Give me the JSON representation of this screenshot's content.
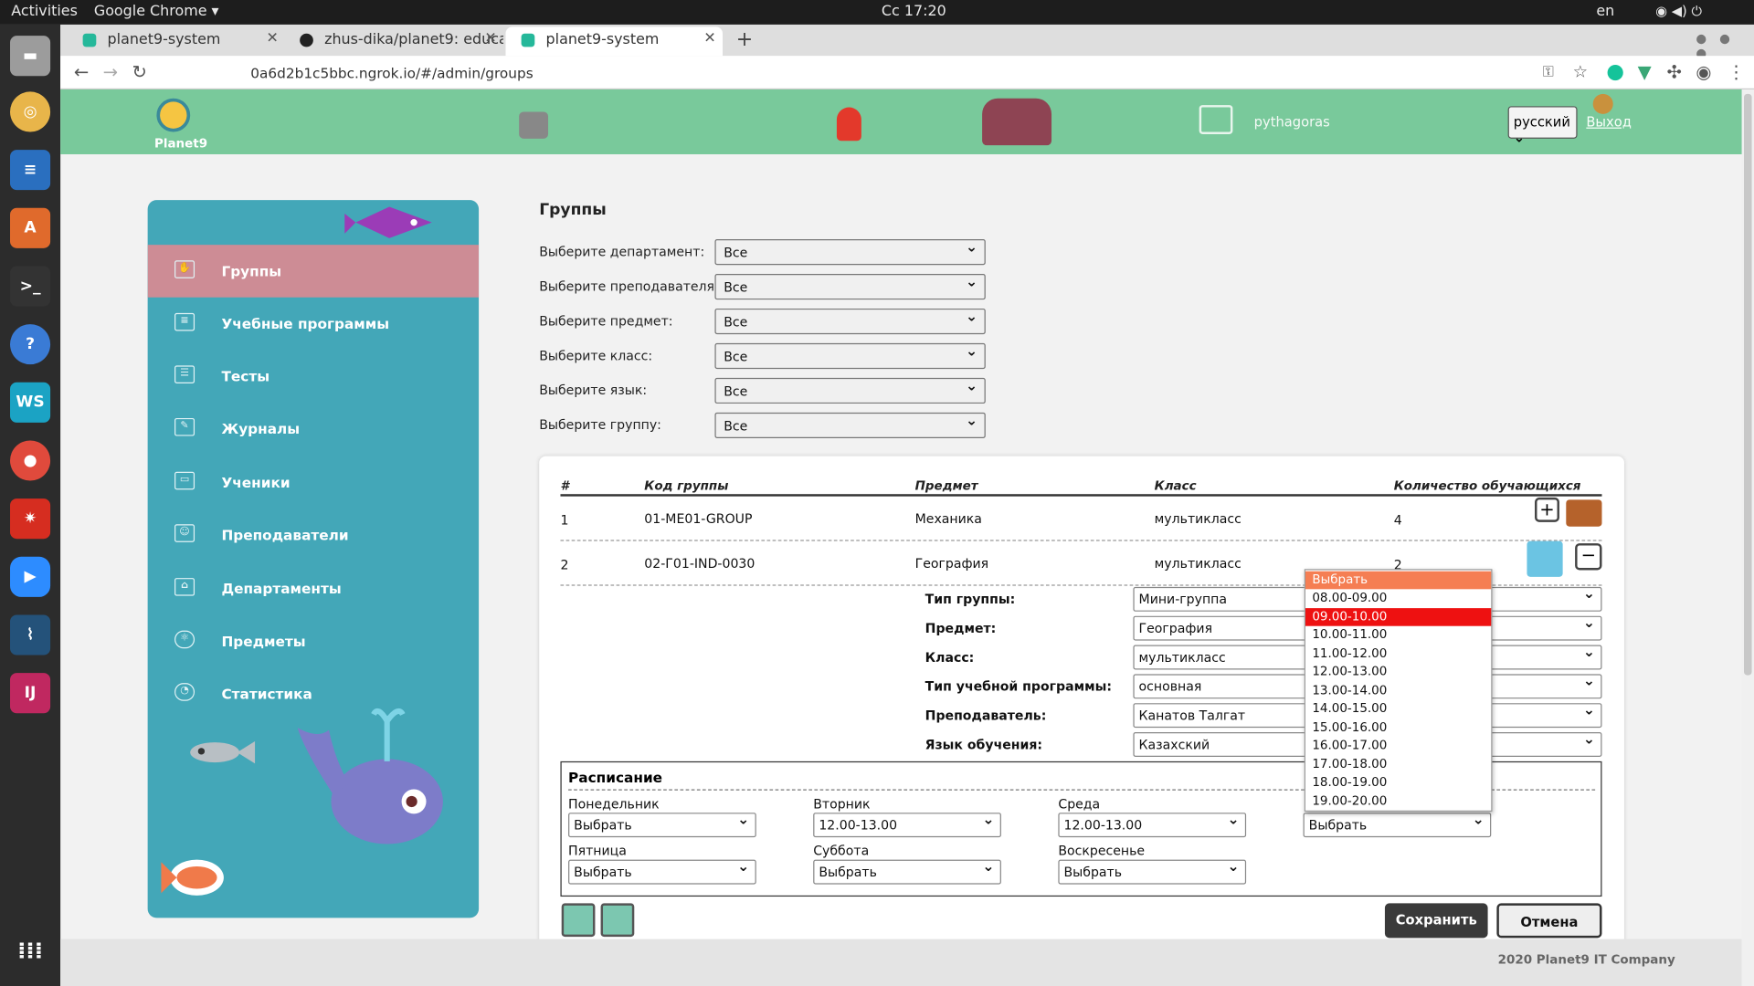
{
  "os": {
    "activities": "Activities",
    "app": "Google Chrome",
    "clock": "Сс 17:20",
    "lang": "en"
  },
  "browser": {
    "tabs": [
      {
        "label": "planet9-system"
      },
      {
        "label": "zhus-dika/planet9: educa"
      },
      {
        "label": "planet9-system"
      }
    ],
    "url": "0a6d2b1c5bbc.ngrok.io/#/admin/groups"
  },
  "header": {
    "logo": "Planet9",
    "username": "pythagoras",
    "language": "русский",
    "logout": "Выход"
  },
  "sidebar": {
    "items": [
      {
        "label": "Группы"
      },
      {
        "label": "Учебные программы"
      },
      {
        "label": "Тесты"
      },
      {
        "label": "Журналы"
      },
      {
        "label": "Ученики"
      },
      {
        "label": "Преподаватели"
      },
      {
        "label": "Департаменты"
      },
      {
        "label": "Предметы"
      },
      {
        "label": "Статистика"
      }
    ]
  },
  "main": {
    "title": "Группы",
    "filters": [
      {
        "label": "Выберите департамент:",
        "value": "Все"
      },
      {
        "label": "Выберите преподавателя:",
        "value": "Все"
      },
      {
        "label": "Выберите предмет:",
        "value": "Все"
      },
      {
        "label": "Выберите класс:",
        "value": "Все"
      },
      {
        "label": "Выберите язык:",
        "value": "Все"
      },
      {
        "label": "Выберите группу:",
        "value": "Все"
      }
    ],
    "table": {
      "headers": [
        "#",
        "Код группы",
        "Предмет",
        "Класс",
        "Количество обучающихся"
      ],
      "rows": [
        [
          "1",
          "01-ME01-GROUP",
          "Механика",
          "мультикласс",
          "4"
        ],
        [
          "2",
          "02-Г01-IND-0030",
          "География",
          "мультикласс",
          "2"
        ]
      ]
    },
    "edit": {
      "fields": [
        {
          "label": "Тип группы:",
          "value": "Мини-группа"
        },
        {
          "label": "Предмет:",
          "value": "География"
        },
        {
          "label": "Класс:",
          "value": "мультикласс"
        },
        {
          "label": "Тип учебной программы:",
          "value": "основная"
        },
        {
          "label": "Преподаватель:",
          "value": "Канатов Талгат"
        },
        {
          "label": "Язык обучения:",
          "value": "Казахский"
        }
      ],
      "schedule_title": "Расписание",
      "days": [
        {
          "label": "Понедельник",
          "value": "Выбрать"
        },
        {
          "label": "Вторник",
          "value": "12.00-13.00"
        },
        {
          "label": "Среда",
          "value": "12.00-13.00"
        },
        {
          "label": "",
          "value": "Выбрать"
        },
        {
          "label": "Пятница",
          "value": "Выбрать"
        },
        {
          "label": "Суббота",
          "value": "Выбрать"
        },
        {
          "label": "Воскресенье",
          "value": "Выбрать"
        }
      ],
      "save": "Сохранить",
      "cancel": "Отмена"
    },
    "dropdown": {
      "options": [
        "Выбрать",
        "08.00-09.00",
        "09.00-10.00",
        "10.00-11.00",
        "11.00-12.00",
        "12.00-13.00",
        "13.00-14.00",
        "14.00-15.00",
        "15.00-16.00",
        "16.00-17.00",
        "17.00-18.00",
        "18.00-19.00",
        "19.00-20.00"
      ],
      "highlighted": "Выбрать",
      "selected": "09.00-10.00"
    }
  },
  "footer": {
    "copyright": "2020 Planet9 IT Company"
  },
  "colors": {
    "header": "#79c99b",
    "sidebar": "#43a7b8",
    "sidebar_active": "#cd8c95",
    "dropdown_hover": "#f57e53",
    "dropdown_selected": "#ee1111"
  }
}
